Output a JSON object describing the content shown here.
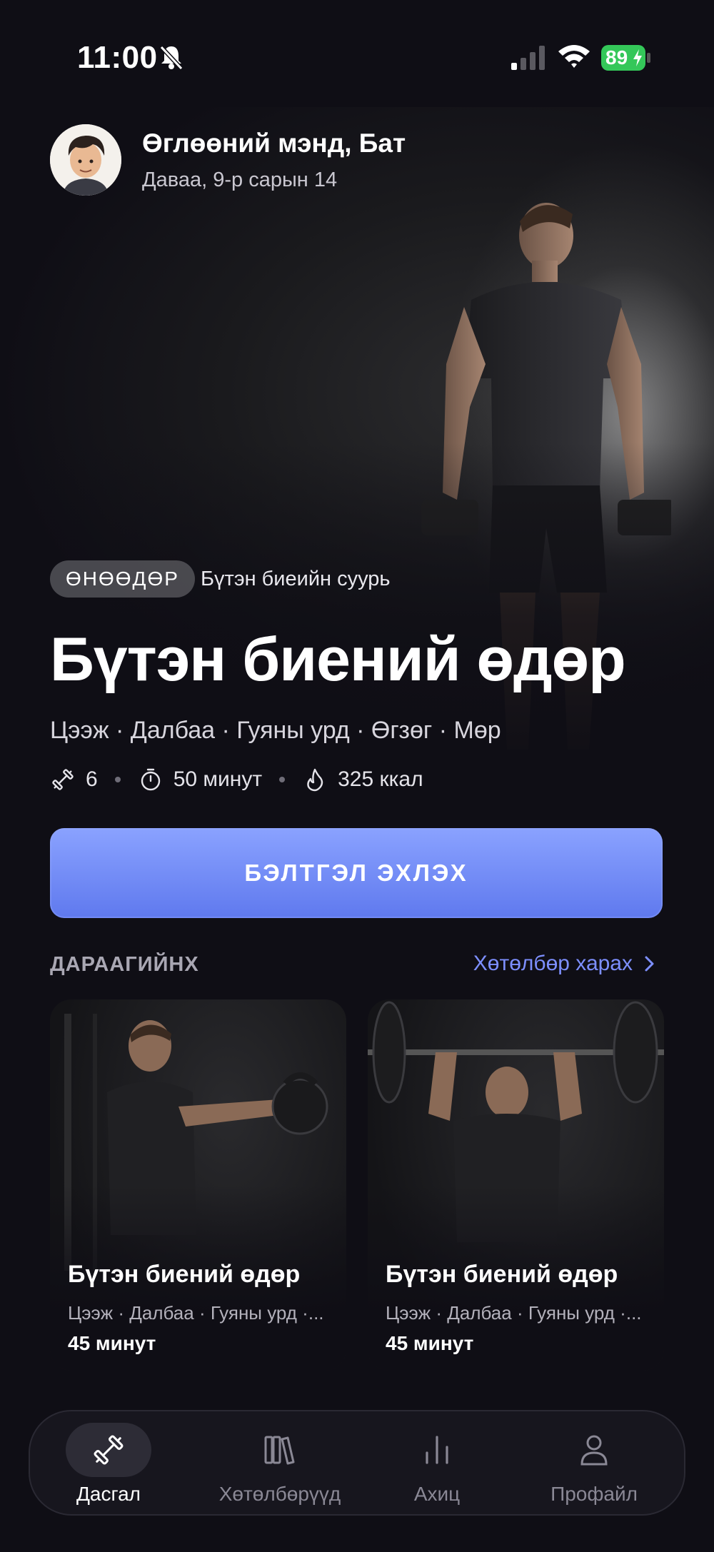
{
  "status_bar": {
    "time": "11:00",
    "battery": "89"
  },
  "greeting": {
    "title": "Өглөөний мэнд, Бат",
    "date": "Даваа, 9-р сарын 14"
  },
  "today": {
    "pill": "ӨНӨӨДӨР",
    "program": "Бүтэн биеийн суурь",
    "title": "Бүтэн биений өдөр",
    "muscles": "Цээж · Далбаа · Гуяны урд · Өгзөг · Мөр",
    "exercises": "6",
    "duration": "50 минут",
    "calories": "325 ккал"
  },
  "start_button": "БЭЛТГЭЛ ЭХЛЭХ",
  "next": {
    "label": "ДАРААГИЙНХ",
    "view_plan": "Хөтөлбөр харах",
    "cards": [
      {
        "title": "Бүтэн биений өдөр",
        "muscles": "Цээж · Далбаа · Гуяны урд ·...",
        "duration": "45 минут"
      },
      {
        "title": "Бүтэн биений өдөр",
        "muscles": "Цээж · Далбаа · Гуяны урд ·...",
        "duration": "45 минут"
      }
    ]
  },
  "nav": [
    {
      "label": "Дасгал",
      "icon": "dumbbell-icon",
      "active": true
    },
    {
      "label": "Хөтөлбөрүүд",
      "icon": "library-icon",
      "active": false
    },
    {
      "label": "Ахиц",
      "icon": "bar-chart-icon",
      "active": false
    },
    {
      "label": "Профайл",
      "icon": "person-icon",
      "active": false
    }
  ],
  "colors": {
    "accent": "#7d8fff",
    "button": "#6f87f5",
    "battery": "#34c759",
    "background": "#0f0e15"
  }
}
